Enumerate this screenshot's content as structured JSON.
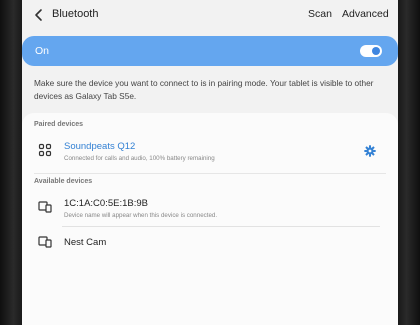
{
  "header": {
    "title": "Bluetooth",
    "scan_label": "Scan",
    "advanced_label": "Advanced"
  },
  "toggle": {
    "label": "On",
    "state": "on",
    "color": "#64a6ef"
  },
  "description": "Make sure the device you want to connect to is in pairing mode. Your tablet is visible to other devices as Galaxy Tab S5e.",
  "paired": {
    "heading": "Paired devices",
    "items": [
      {
        "name": "Soundpeats Q12",
        "status": "Connected for calls and audio, 100% battery remaining",
        "icon": "headphones-icon"
      }
    ]
  },
  "available": {
    "heading": "Available devices",
    "items": [
      {
        "name": "1C:1A:C0:5E:1B:9B",
        "status": "Device name will appear when this device is connected.",
        "icon": "devices-icon"
      },
      {
        "name": "Nest Cam",
        "status": "",
        "icon": "devices-icon"
      }
    ]
  },
  "colors": {
    "accent": "#3381d4",
    "background": "#f2f2f2"
  }
}
